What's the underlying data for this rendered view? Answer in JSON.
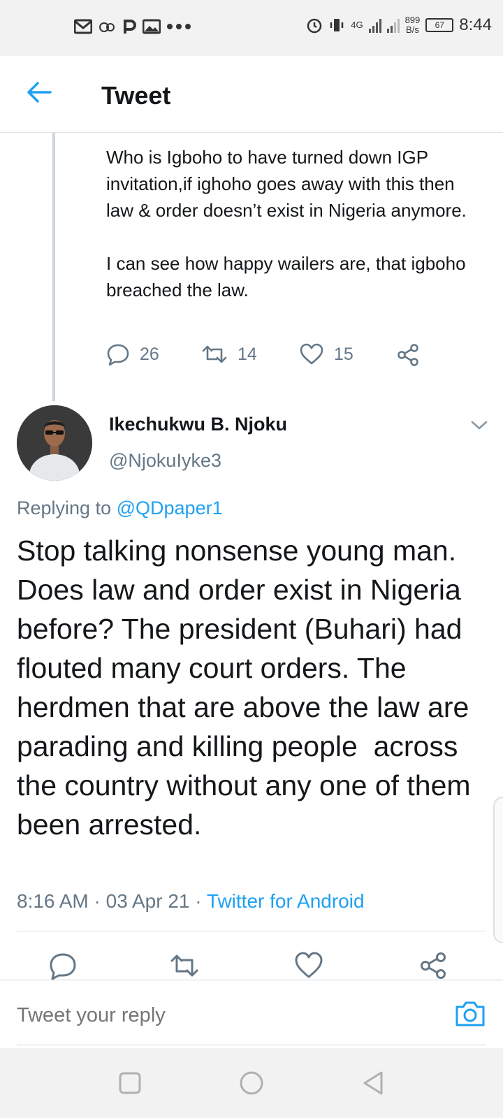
{
  "status_bar": {
    "time": "8:44",
    "network_speed": "899",
    "network_unit": "B/s",
    "battery": "67",
    "network_type": "4G"
  },
  "header": {
    "title": "Tweet"
  },
  "previous_tweet": {
    "paragraphs": [
      "Who is Igboho to have turned down IGP invitation,if ighoho goes away with this then law & order doesn’t exist in Nigeria anymore.",
      "I can see how happy wailers are, that igboho breached the law."
    ],
    "replies": "26",
    "retweets": "14",
    "likes": "15"
  },
  "tweet": {
    "author_name": "Ikechukwu B. Njoku",
    "author_handle": "@NjokuIyke3",
    "replying_label": "Replying to",
    "replying_to": "@QDpaper1",
    "text": "Stop talking nonsense young man. Does law and order exist in Nigeria before? The president (Buhari) had flouted many court orders. The herdmen that are above the law are parading and killing people  across the country without any one of them been arrested.",
    "time": "8:16 AM",
    "date": "03 Apr 21",
    "source": "Twitter for Android"
  },
  "reply_bar": {
    "placeholder": "Tweet your reply"
  },
  "colors": {
    "accent": "#1da1f2",
    "secondary_text": "#657786",
    "primary_text": "#14171a"
  }
}
